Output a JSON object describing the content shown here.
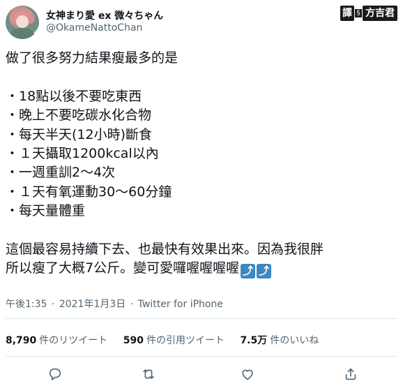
{
  "user": {
    "display_name": "女神まり愛 ex 微々ちゃん",
    "handle": "@OkameNattoChan"
  },
  "watermark": {
    "left": "譯",
    "dot": "§",
    "right": "方吉君"
  },
  "tweet": {
    "lines": [
      "做了很多努力結果瘦最多的是",
      "",
      "・18點以後不要吃東西",
      "・晚上不要吃碳水化合物",
      "・每天半天(12小時)斷食",
      "・１天攝取1200kcal以內",
      "・一週重訓2～4次",
      "・１天有氧運動30～60分鐘",
      "・每天量體重",
      "",
      "這個最容易持續下去、也最快有效果出來。因為我很胖",
      "所以瘦了大概7公斤。變可愛囉喔喔喔喔"
    ],
    "emoji": "⤴"
  },
  "meta": {
    "time": "午後1:35",
    "separator": "·",
    "date": "2021年1月3日",
    "source": "Twitter for iPhone"
  },
  "stats": {
    "retweets_num": "8,790",
    "retweets_label": "件のリツイート",
    "quotes_num": "590",
    "quotes_label": "件の引用ツイート",
    "likes_num": "7.5万",
    "likes_label": "件のいいね"
  },
  "icons": [
    "reply-icon",
    "retweet-icon",
    "like-icon",
    "share-icon"
  ]
}
